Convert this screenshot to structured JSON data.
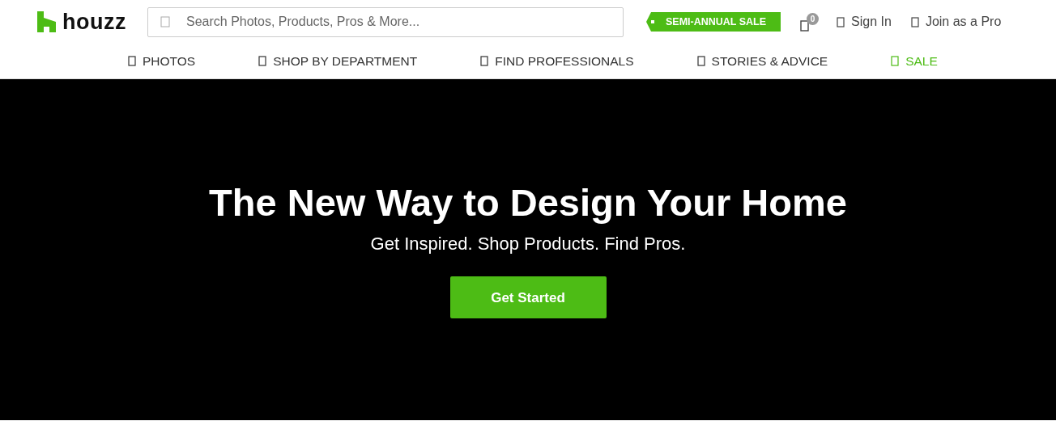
{
  "logo": {
    "text": "houzz"
  },
  "search": {
    "placeholder": "Search Photos, Products, Pros & More..."
  },
  "promo_tag": {
    "label": "SEMI-ANNUAL SALE"
  },
  "cart": {
    "count": "0"
  },
  "header_links": [
    {
      "label": "Sign In"
    },
    {
      "label": "Join as a Pro"
    }
  ],
  "nav": [
    {
      "label": "PHOTOS",
      "highlighted": false
    },
    {
      "label": "SHOP BY DEPARTMENT",
      "highlighted": false
    },
    {
      "label": "FIND PROFESSIONALS",
      "highlighted": false
    },
    {
      "label": "STORIES & ADVICE",
      "highlighted": false
    },
    {
      "label": "SALE",
      "highlighted": true
    }
  ],
  "hero": {
    "title": "The New Way to Design Your Home",
    "subtitle": "Get Inspired. Shop Products. Find Pros.",
    "button": "Get Started"
  }
}
